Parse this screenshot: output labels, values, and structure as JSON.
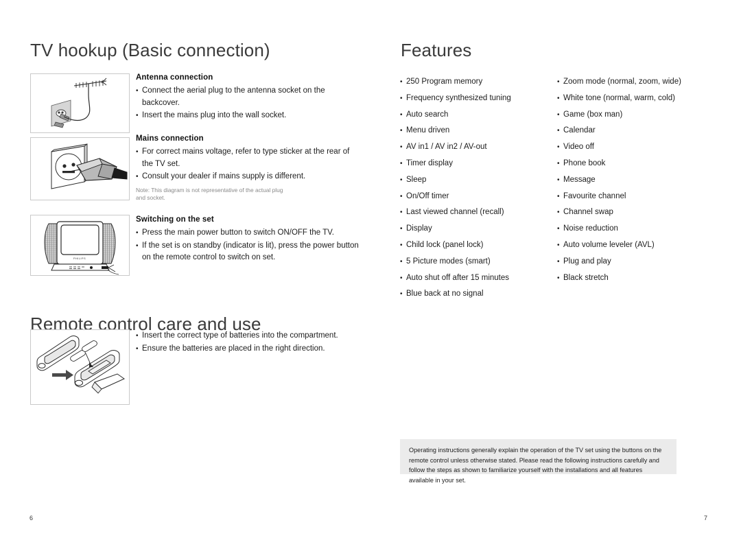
{
  "left_page": {
    "title": "TV hookup (Basic connection)",
    "remote_title": "Remote control care and use",
    "page_number": "6",
    "sections": [
      {
        "heading": "Antenna connection",
        "bullets": [
          "Connect the aerial plug to the antenna socket on the backcover.",
          "Insert the mains plug into the wall socket."
        ],
        "figure": "antenna-wall-socket-diagram"
      },
      {
        "heading": "Mains connection",
        "bullets": [
          "For correct mains voltage, refer to type sticker at the rear of the TV set.",
          "Consult your dealer if mains supply is different."
        ],
        "note": "Note: This diagram is not representative of the actual plug and socket.",
        "figure": "mains-plug-socket-diagram"
      },
      {
        "heading": "Switching on the set",
        "bullets": [
          "Press the main power button to switch ON/OFF the TV.",
          "If the set is on standby (indicator is lit), press the power button on the remote control to switch on set."
        ],
        "figure": "tv-front-diagram"
      }
    ],
    "remote_section": {
      "bullets": [
        "Insert the correct type of batteries into the compartment.",
        "Ensure the batteries are placed in the right direction."
      ],
      "figure": "remote-control-battery-diagram"
    }
  },
  "right_page": {
    "title": "Features",
    "page_number": "7",
    "features_column_1": [
      "250 Program memory",
      "Frequency synthesized tuning",
      "Auto search",
      "Menu driven",
      "AV in1 / AV in2 / AV-out",
      "Timer display",
      "Sleep",
      "On/Off timer",
      "Last viewed channel (recall)",
      "Display",
      "Child lock (panel lock)",
      "5 Picture modes (smart)",
      "Auto shut off after 15 minutes",
      "Blue back at no signal"
    ],
    "features_column_2": [
      "Zoom mode (normal, zoom, wide)",
      "White tone (normal, warm, cold)",
      "Game (box man)",
      "Calendar",
      "Video off",
      "Phone book",
      "Message",
      "Favourite channel",
      "Channel swap",
      "Noise reduction",
      "Auto volume leveler (AVL)",
      "Plug and play",
      "Black stretch"
    ],
    "operating_note": "Operating instructions generally explain the operation of the TV set using the buttons on the remote control unless otherwise stated. Please read the following instructions carefully and follow the steps as shown to familiarize yourself with the installations and all features available in your set."
  },
  "colors": {
    "heading": "#3b3b3b",
    "body_text": "#1c1c1c",
    "note_text": "#8a8a8a",
    "note_box_background": "#ebebeb",
    "figure_border": "#c9c9c9",
    "page_background": "#ffffff"
  },
  "tv_brand_label": "PHILIPS"
}
